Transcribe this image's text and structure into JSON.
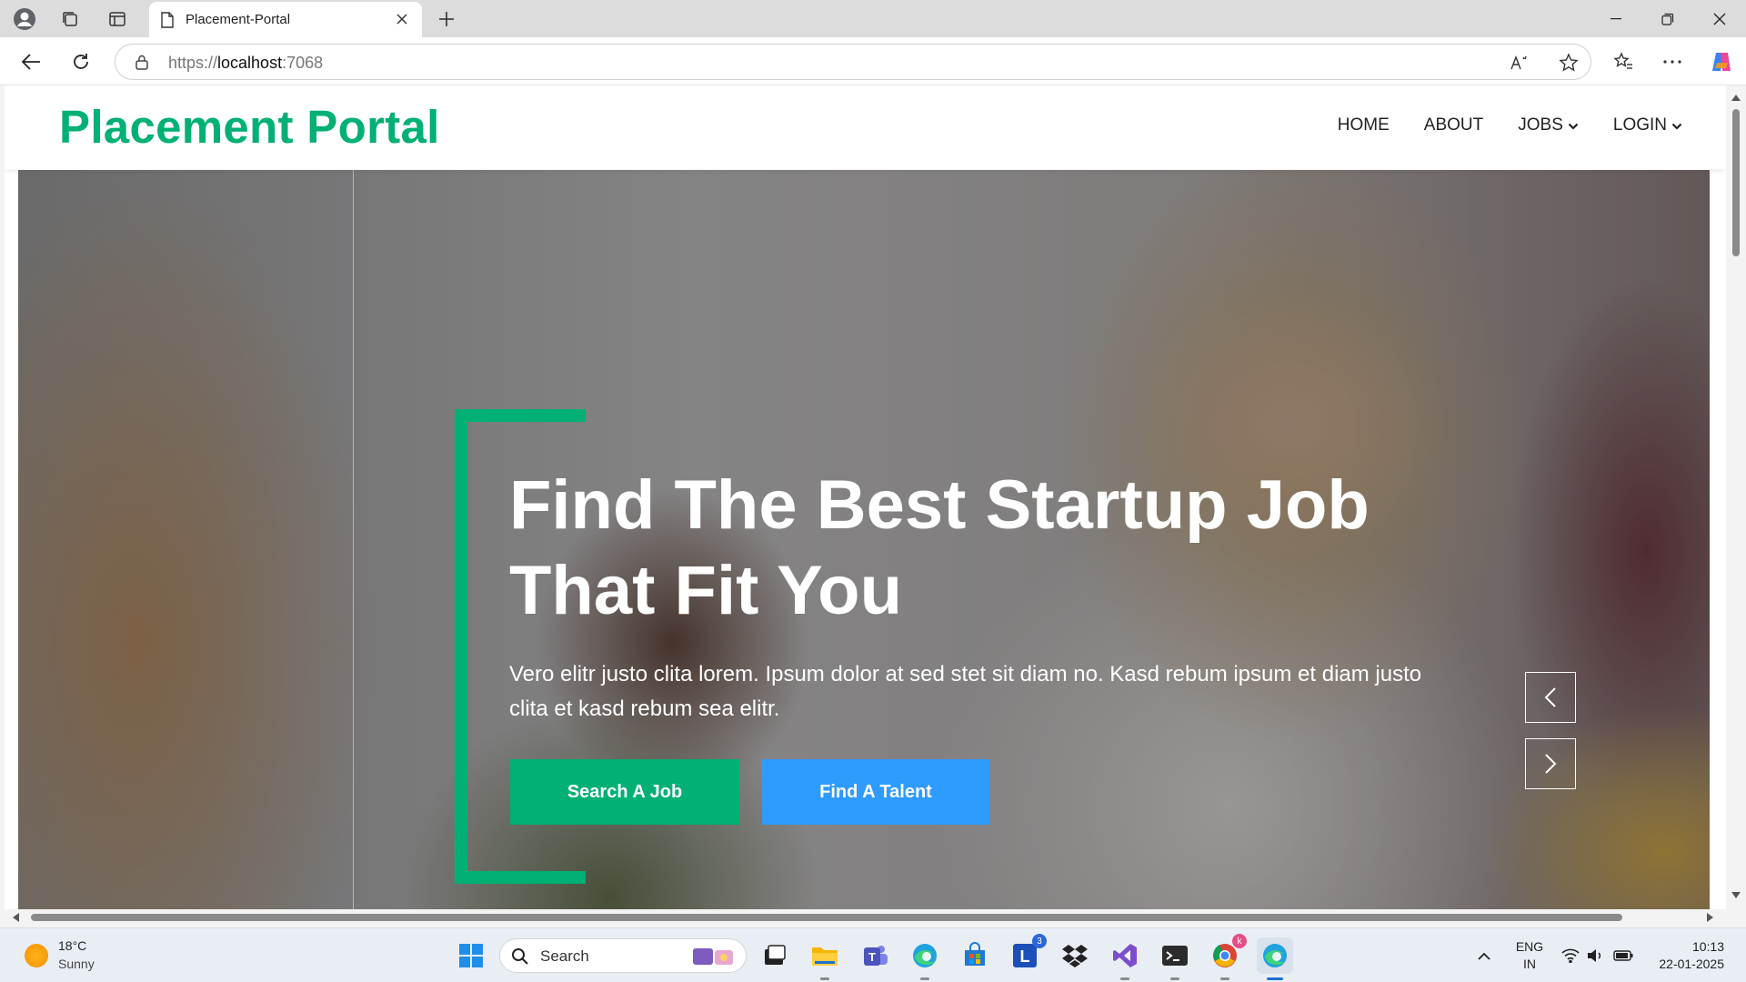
{
  "browser": {
    "tab_title": "Placement-Portal",
    "url_prefix": "https://",
    "url_host": "localhost",
    "url_port": ":7068"
  },
  "site": {
    "logo": "Placement Portal",
    "nav": {
      "home": "HOME",
      "about": "ABOUT",
      "jobs": "JOBS",
      "login": "LOGIN"
    }
  },
  "hero": {
    "title_line1": "Find The Best Startup Job",
    "title_line2": "That Fit You",
    "subtitle": "Vero elitr justo clita lorem. Ipsum dolor at sed stet sit diam no. Kasd rebum ipsum et diam justo clita et kasd rebum sea elitr.",
    "primary_button": "Search A Job",
    "secondary_button": "Find A Talent"
  },
  "colors": {
    "brand_green": "#00b074",
    "accent_blue": "#2e9bff"
  },
  "taskbar": {
    "weather_temp": "18°C",
    "weather_desc": "Sunny",
    "search_label": "Search",
    "lang_top": "ENG",
    "lang_bottom": "IN",
    "time": "10:13",
    "date": "22-01-2025",
    "word_badge": "3"
  }
}
